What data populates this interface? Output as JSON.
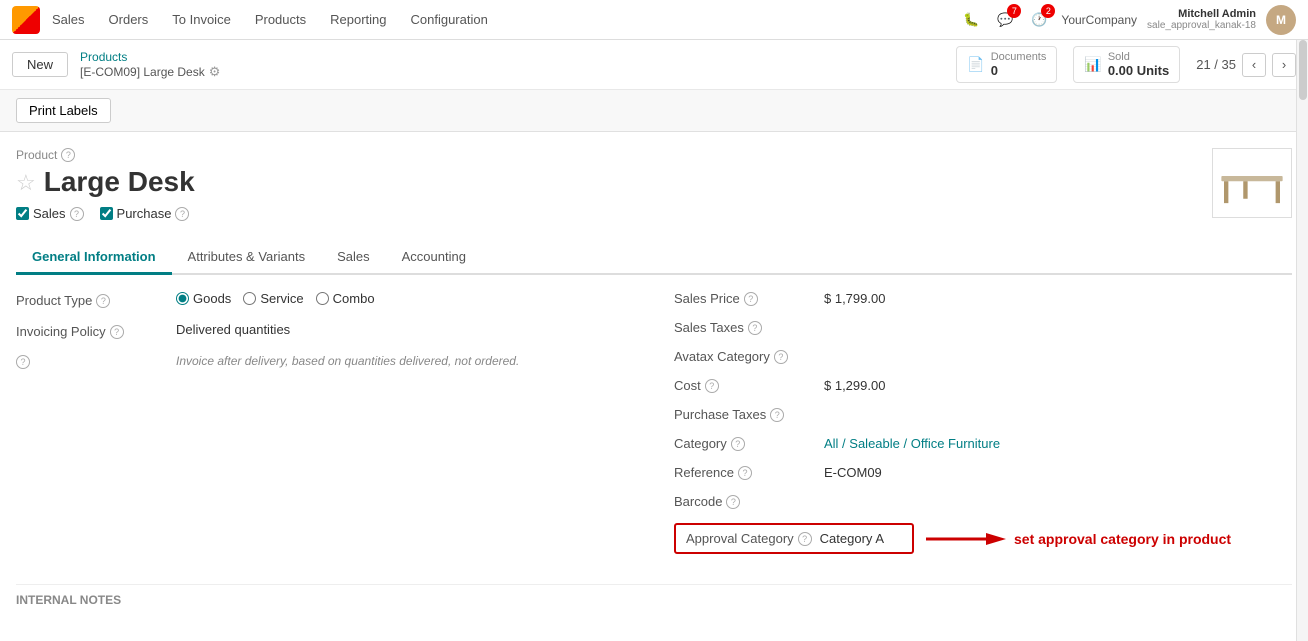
{
  "nav": {
    "logo_label": "Odoo",
    "items": [
      "Sales",
      "Orders",
      "To Invoice",
      "Products",
      "Reporting",
      "Configuration"
    ]
  },
  "topright": {
    "bug_icon": "🐛",
    "chat_badge": "7",
    "activity_badge": "2",
    "company": "YourCompany",
    "user_name": "Mitchell Admin",
    "user_sub": "sale_approval_kanak-18"
  },
  "actionbar": {
    "new_label": "New",
    "breadcrumb_top": "Products",
    "breadcrumb_bottom": "[E-COM09] Large Desk",
    "docs_label": "Documents",
    "docs_count": "0",
    "sold_label": "Sold",
    "sold_value": "0.00 Units",
    "pager": "21 / 35"
  },
  "toolbar": {
    "print_labels": "Print Labels"
  },
  "product": {
    "label": "Product",
    "name": "Large Desk",
    "sales_checked": true,
    "purchase_checked": true,
    "sales_label": "Sales",
    "purchase_label": "Purchase"
  },
  "tabs": [
    {
      "id": "general",
      "label": "General Information",
      "active": true
    },
    {
      "id": "attributes",
      "label": "Attributes & Variants",
      "active": false
    },
    {
      "id": "sales",
      "label": "Sales",
      "active": false
    },
    {
      "id": "accounting",
      "label": "Accounting",
      "active": false
    }
  ],
  "left_fields": {
    "product_type_label": "Product Type",
    "product_type_options": [
      "Goods",
      "Service",
      "Combo"
    ],
    "product_type_selected": "Goods",
    "invoicing_label": "Invoicing Policy",
    "invoicing_value": "Delivered quantities",
    "invoicing_note": "Invoice after delivery, based on quantities delivered, not ordered."
  },
  "right_fields": {
    "sales_price_label": "Sales Price",
    "sales_price_value": "$ 1,799.00",
    "sales_taxes_label": "Sales Taxes",
    "sales_taxes_value": "",
    "avatax_label": "Avatax Category",
    "avatax_value": "",
    "cost_label": "Cost",
    "cost_value": "$ 1,299.00",
    "purchase_taxes_label": "Purchase Taxes",
    "purchase_taxes_value": "",
    "category_label": "Category",
    "category_value": "All / Saleable / Office Furniture",
    "reference_label": "Reference",
    "reference_value": "E-COM09",
    "barcode_label": "Barcode",
    "barcode_value": "",
    "approval_category_label": "Approval Category",
    "approval_category_value": "Category A",
    "approval_annotation": "set approval category in product"
  },
  "internal_notes": {
    "label": "INTERNAL NOTES"
  }
}
